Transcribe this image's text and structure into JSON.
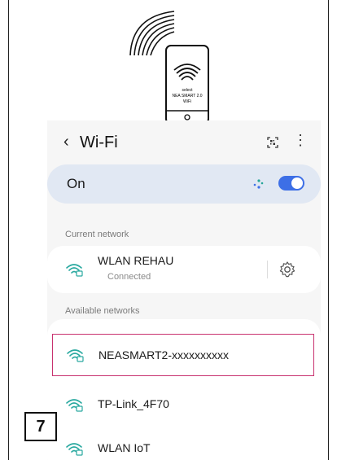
{
  "illustration": {
    "phone_text_line1": "select",
    "phone_text_line2": "NEA SMART 2.0",
    "phone_text_line3": "WiFi"
  },
  "header": {
    "back_icon": "chevron-left-icon",
    "title": "Wi-Fi",
    "qr_icon": "qr-scan-icon",
    "more_icon": "more-vert-icon",
    "more_glyph": "⋮"
  },
  "wifi_toggle": {
    "label": "On",
    "state": "on",
    "accent_color": "#3d6fe6"
  },
  "current_network": {
    "section_label": "Current network",
    "name": "WLAN REHAU",
    "status": "Connected",
    "settings_icon": "gear-icon"
  },
  "available_networks": {
    "section_label": "Available networks",
    "items": [
      {
        "name": "NEASMART2-xxxxxxxxxx",
        "icon": "wifi-lock-icon",
        "highlighted": true
      },
      {
        "name": "TP-Link_4F70",
        "icon": "wifi-lock-icon",
        "highlighted": false
      },
      {
        "name": "WLAN IoT",
        "icon": "wifi-lock-icon",
        "highlighted": false
      }
    ]
  },
  "step": {
    "number": "7"
  },
  "colors": {
    "highlight_border": "#c8326f",
    "panel_bg": "#f6f6f6"
  }
}
